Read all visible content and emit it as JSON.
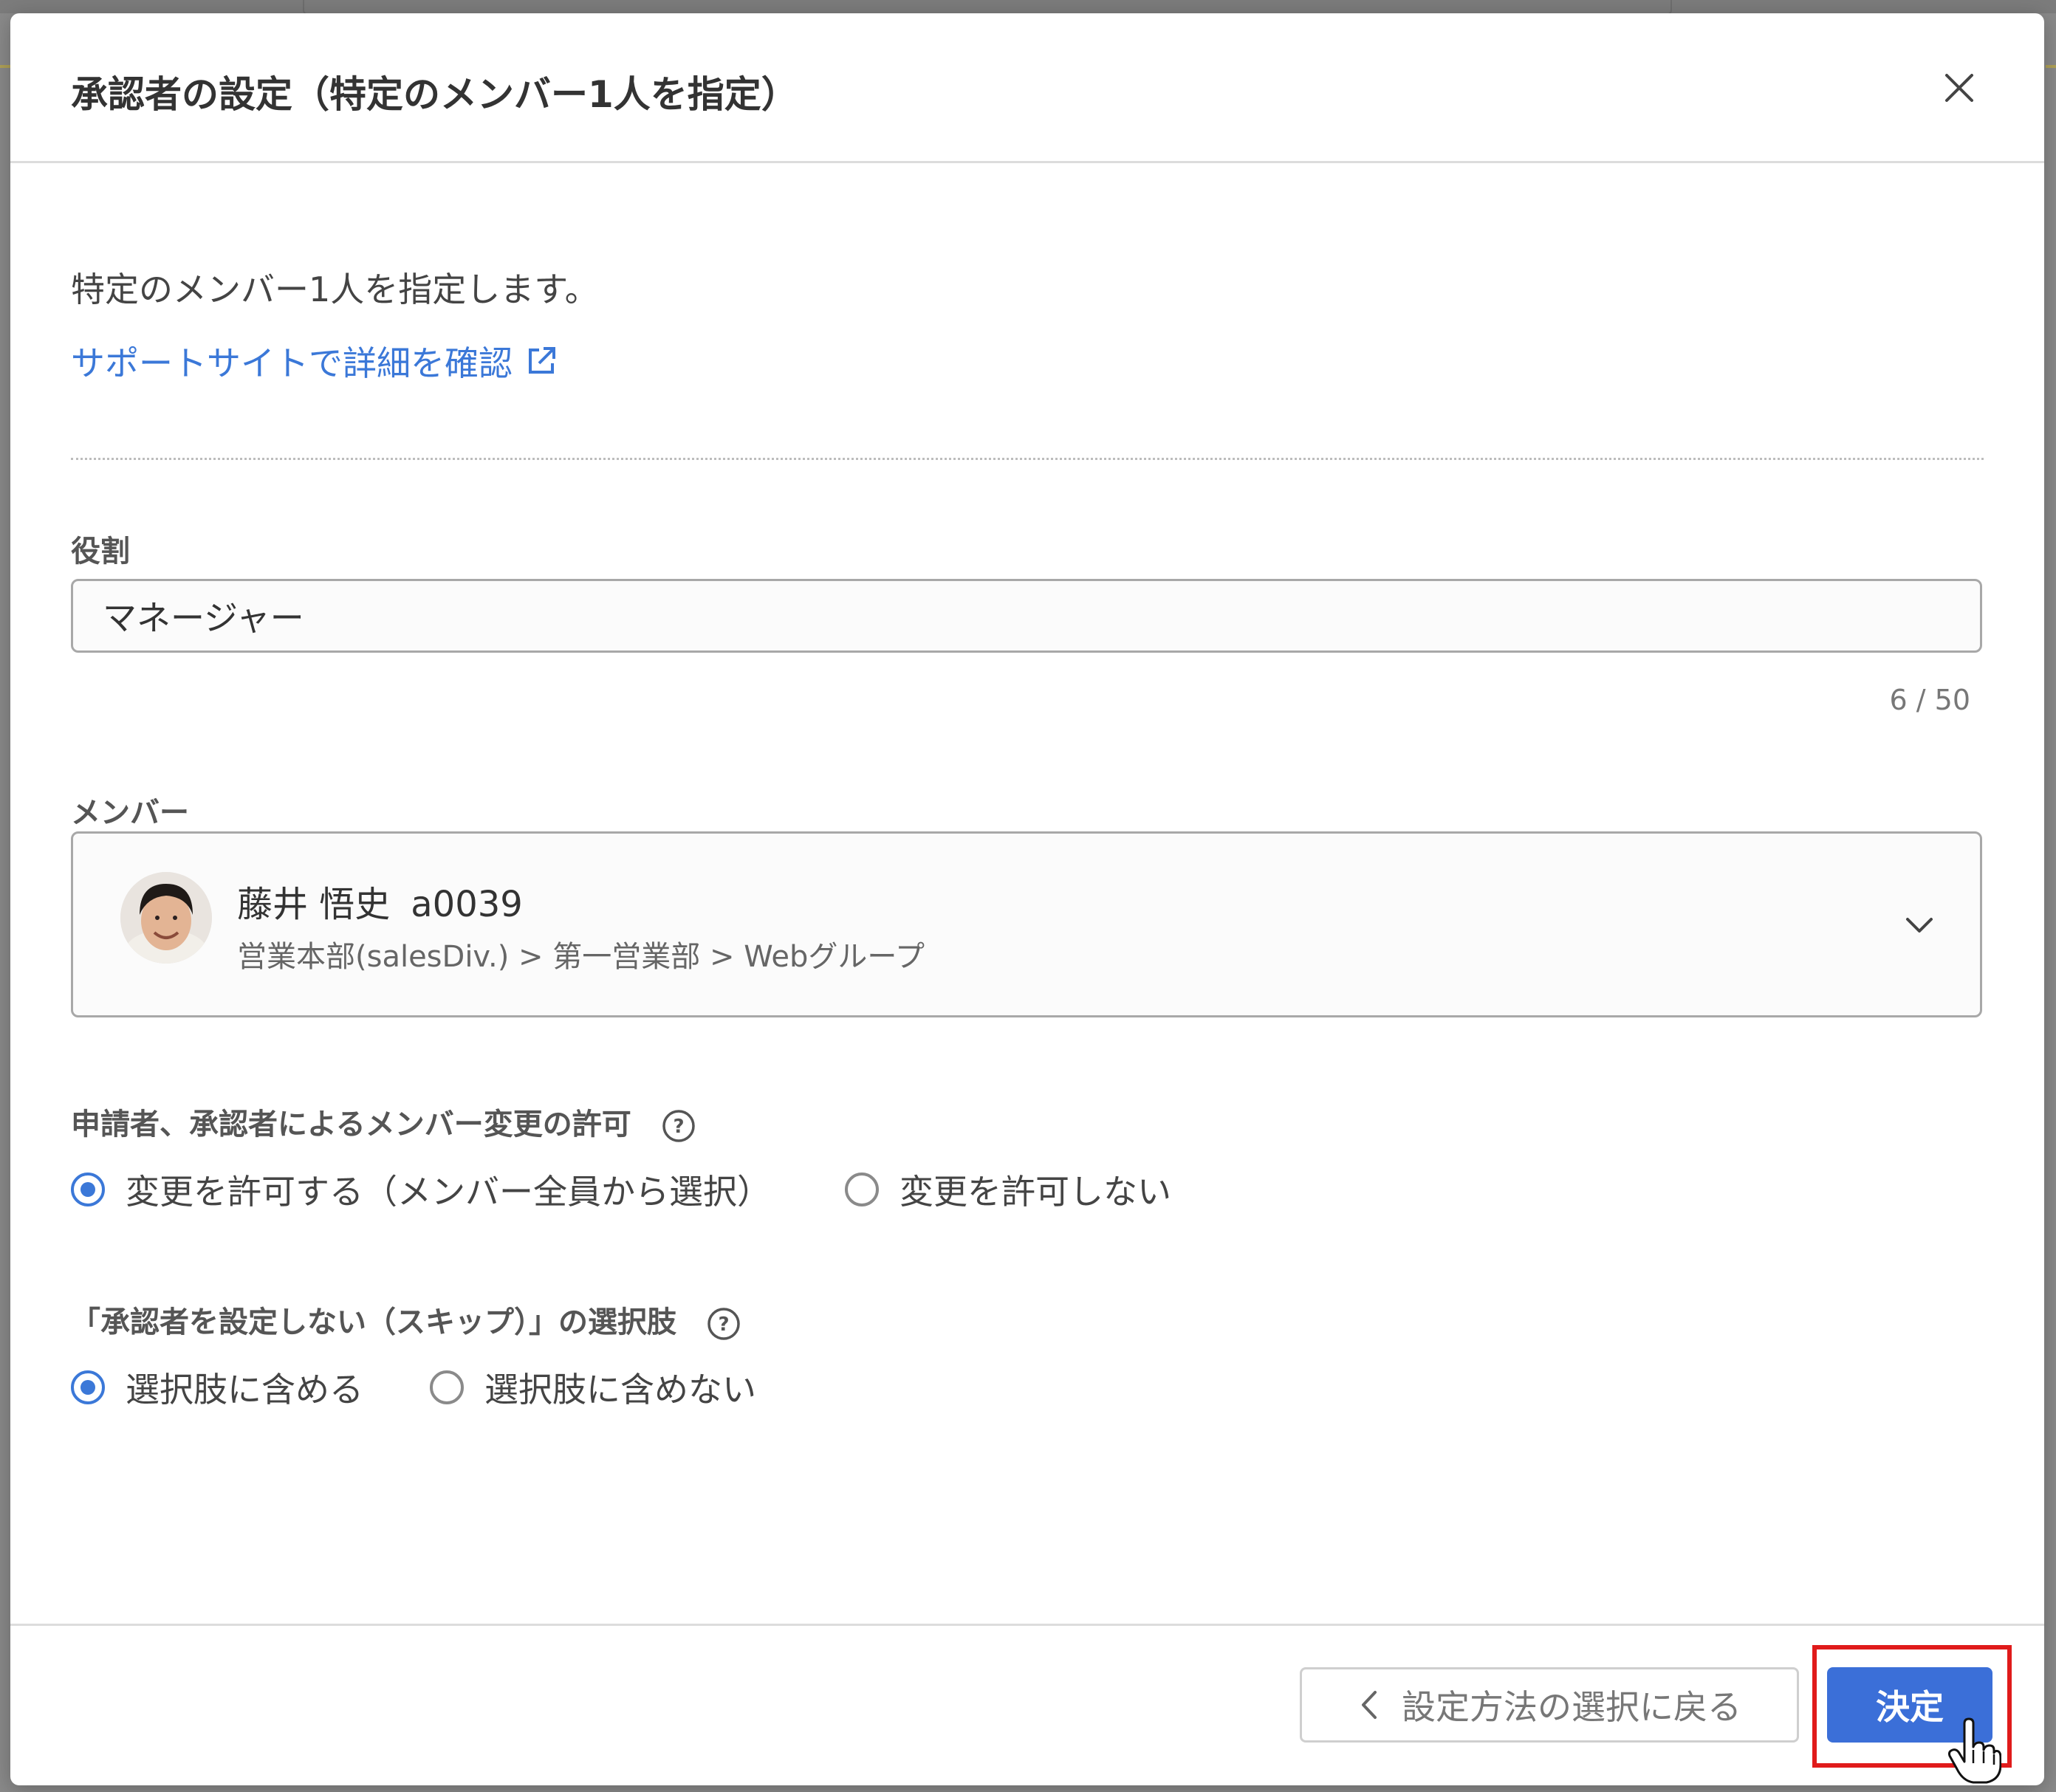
{
  "dialog": {
    "title": "承認者の設定（特定のメンバー1人を指定）",
    "description": "特定のメンバー1人を指定します。",
    "help_link": "サポートサイトで詳細を確認"
  },
  "role": {
    "label": "役割",
    "value": "マネージャー",
    "counter": "6 / 50"
  },
  "member": {
    "label": "メンバー",
    "name": "藤井 悟史",
    "code": "a0039",
    "path": "営業本部(salesDiv.) > 第一営業部 > Webグループ"
  },
  "change_permission": {
    "label": "申請者、承認者によるメンバー変更の許可",
    "options": [
      {
        "label": "変更を許可する（メンバー全員から選択）",
        "checked": true
      },
      {
        "label": "変更を許可しない",
        "checked": false
      }
    ]
  },
  "skip_option": {
    "label": "「承認者を設定しない（スキップ）」の選択肢",
    "options": [
      {
        "label": "選択肢に含める",
        "checked": true
      },
      {
        "label": "選択肢に含めない",
        "checked": false
      }
    ]
  },
  "footer": {
    "back_label": "設定方法の選択に戻る",
    "decide_label": "決定"
  },
  "colors": {
    "accent": "#3b78d8",
    "primary_button": "#3b6fd8",
    "highlight": "#e01b1b"
  },
  "icons": [
    "close-icon",
    "external-link-icon",
    "chevron-down-icon",
    "help-icon",
    "chevron-left-icon",
    "hand-pointer-icon"
  ]
}
